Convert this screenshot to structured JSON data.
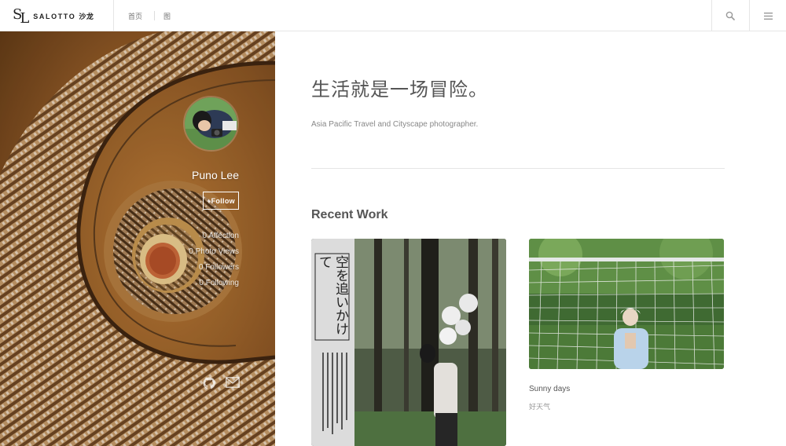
{
  "brand": {
    "mark": [
      "S",
      "L"
    ],
    "name": "SALOTTO",
    "name_cn": "沙龙"
  },
  "nav": {
    "items": [
      "首页",
      "图"
    ]
  },
  "icons": {
    "search": "search-icon",
    "menu": "hamburger-menu-icon",
    "github": "github-icon",
    "mail": "mail-icon"
  },
  "profile": {
    "name": "Puno Lee",
    "follow_label": "+Follow",
    "stats": {
      "affection": "0 Affection",
      "photo_views": "0 Photo Views",
      "followers": "0 Followers",
      "following": "0 Following"
    }
  },
  "main": {
    "headline": "生活就是一场冒险。",
    "subtitle": "Asia Pacific Travel and Cityscape photographer.",
    "section_title": "Recent Work"
  },
  "works": [
    {
      "poster_text": "空を追いかけて"
    },
    {
      "title": "Sunny days",
      "subtitle": "好天气"
    }
  ],
  "colors": {
    "accent_brown": "#8b5a26",
    "border": "#e6e6e6",
    "text": "#555555"
  }
}
